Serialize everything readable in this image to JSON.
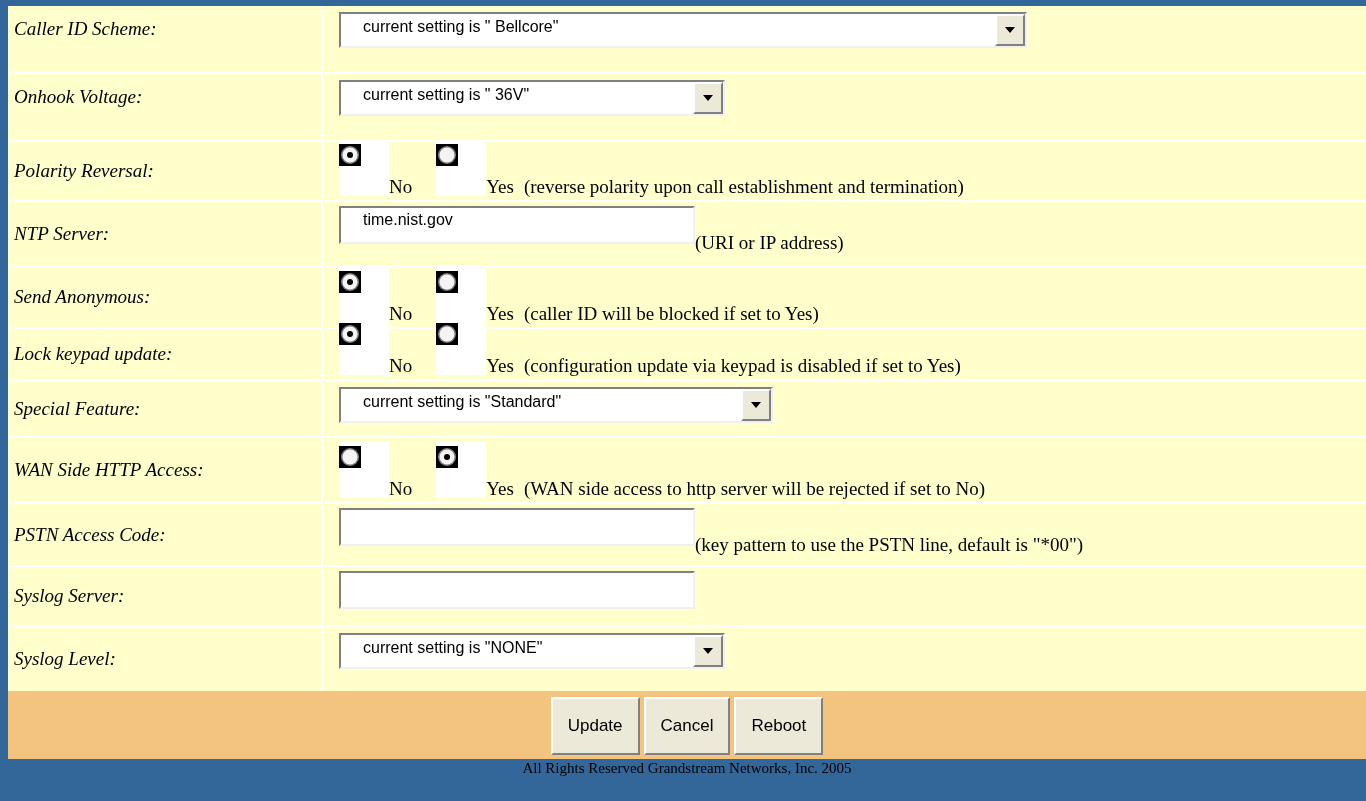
{
  "settings": [
    {
      "kind": "select",
      "label": "Caller ID Scheme:",
      "value": "current setting is \" Bellcore\""
    },
    {
      "kind": "select",
      "label": "Onhook Voltage:",
      "value": "current setting is \" 36V\""
    },
    {
      "kind": "radio",
      "label": "Polarity Reversal:",
      "options": [
        {
          "label": "No",
          "selected": true
        },
        {
          "label": "Yes",
          "selected": false
        }
      ],
      "note": "(reverse polarity upon call establishment and termination)"
    },
    {
      "kind": "text",
      "label": "NTP Server:",
      "value": "time.nist.gov",
      "note": "(URI or IP address)"
    },
    {
      "kind": "radio",
      "label": "Send Anonymous:",
      "options": [
        {
          "label": "No",
          "selected": true
        },
        {
          "label": "Yes",
          "selected": false
        }
      ],
      "note": "(caller ID will be blocked if set to Yes)"
    },
    {
      "kind": "radio",
      "label": "Lock keypad update:",
      "options": [
        {
          "label": "No",
          "selected": true
        },
        {
          "label": "Yes",
          "selected": false
        }
      ],
      "note": "(configuration update via keypad is disabled if set to Yes)"
    },
    {
      "kind": "select",
      "label": "Special Feature:",
      "value": "current setting is \"Standard\""
    },
    {
      "kind": "radio",
      "label": "WAN Side HTTP Access:",
      "options": [
        {
          "label": "No",
          "selected": false
        },
        {
          "label": "Yes",
          "selected": true
        }
      ],
      "note": "(WAN side access to http server will be rejected if set to No)"
    },
    {
      "kind": "text",
      "label": "PSTN Access Code:",
      "note": "(key pattern to use the PSTN line, default is \"*00\")"
    },
    {
      "kind": "text",
      "label": "Syslog Server:"
    },
    {
      "kind": "select",
      "label": "Syslog Level:",
      "value": "current setting is \"NONE\""
    }
  ],
  "buttons": [
    "Update",
    "Cancel",
    "Reboot"
  ],
  "footer": "All Rights Reserved Grandstream Networks, Inc. 2005"
}
